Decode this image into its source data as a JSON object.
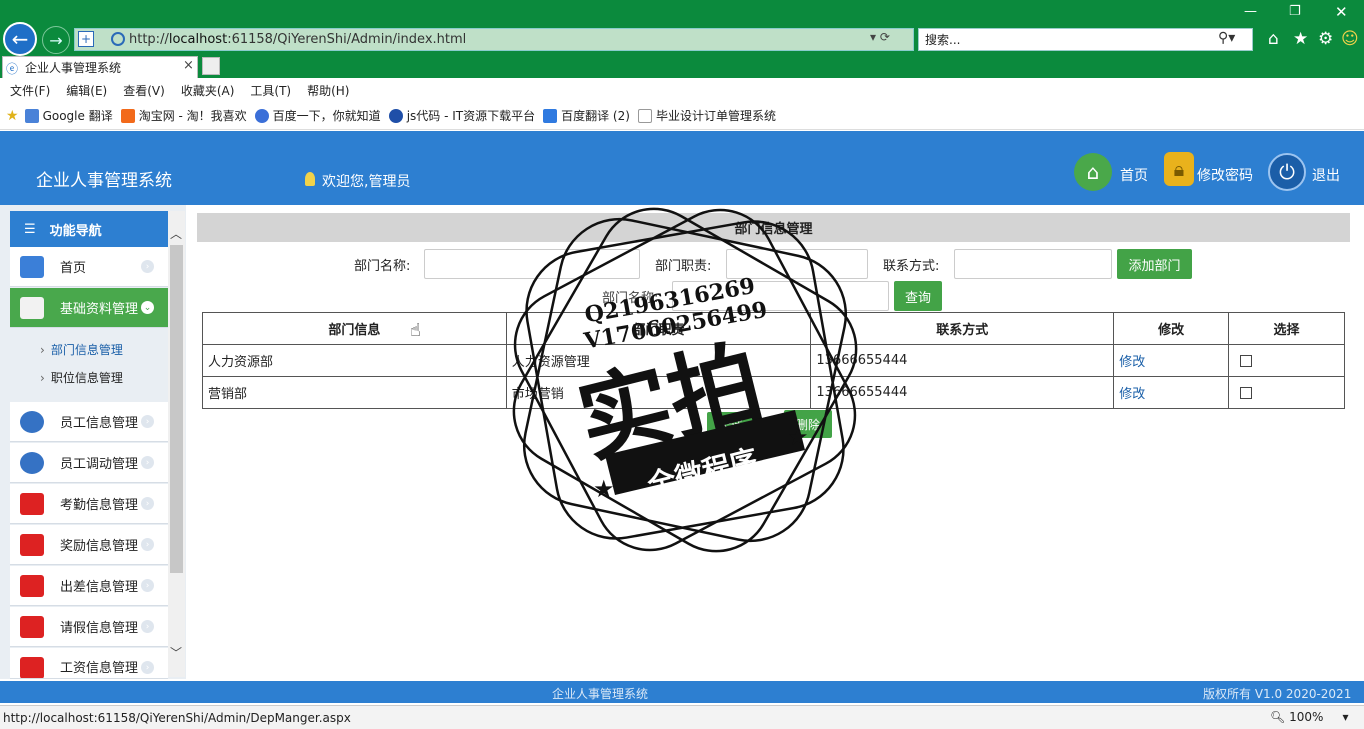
{
  "browser": {
    "url_prefix": "http://",
    "url_host": "localhost",
    "url_rest": ":61158/QiYerenShi/Admin/index.html",
    "search_placeholder": "搜索...",
    "tab_title": "企业人事管理系统",
    "menu": [
      "文件(F)",
      "编辑(E)",
      "查看(V)",
      "收藏夹(A)",
      "工具(T)",
      "帮助(H)"
    ],
    "favorites": [
      "Google 翻译",
      "淘宝网 - 淘！我喜欢",
      "百度一下，你就知道",
      "js代码 - IT资源下载平台",
      "百度翻译 (2)",
      "毕业设计订单管理系统"
    ],
    "status_url": "http://localhost:61158/QiYerenShi/Admin/DepManger.aspx",
    "zoom": "100%"
  },
  "header": {
    "title": "企业人事管理系统",
    "welcome": "欢迎您,管理员",
    "home": "首页",
    "change_password": "修改密码",
    "logout": "退出"
  },
  "sidebar": {
    "title": "功能导航",
    "items": [
      {
        "label": "首页"
      },
      {
        "label": "基础资料管理"
      },
      {
        "label": "员工信息管理"
      },
      {
        "label": "员工调动管理"
      },
      {
        "label": "考勤信息管理"
      },
      {
        "label": "奖励信息管理"
      },
      {
        "label": "出差信息管理"
      },
      {
        "label": "请假信息管理"
      },
      {
        "label": "工资信息管理"
      }
    ],
    "sub_items": [
      "部门信息管理",
      "职位信息管理"
    ]
  },
  "main": {
    "panel_title": "部门信息管理",
    "form": {
      "name_label": "部门名称:",
      "duty_label": "部门职责:",
      "contact_label": "联系方式:",
      "add_button": "添加部门",
      "search_label": "部门名称:",
      "query_button": "查询"
    },
    "table": {
      "headers": [
        "部门信息",
        "部门职责",
        "联系方式",
        "修改",
        "选择"
      ],
      "rows": [
        {
          "name": "人力资源部",
          "duty": "人力资源管理",
          "contact": "13666655444",
          "edit": "修改"
        },
        {
          "name": "营销部",
          "duty": "市场营销",
          "contact": "13666655444",
          "edit": "修改"
        }
      ]
    },
    "select_all": "全选",
    "delete": "删除"
  },
  "watermark": {
    "line1": "Q2196316269",
    "line2": "V17060256499",
    "big": "实拍",
    "banner": "全微程序"
  },
  "footer": {
    "center": "企业人事管理系统",
    "right": "版权所有 V1.0 2020-2021"
  }
}
